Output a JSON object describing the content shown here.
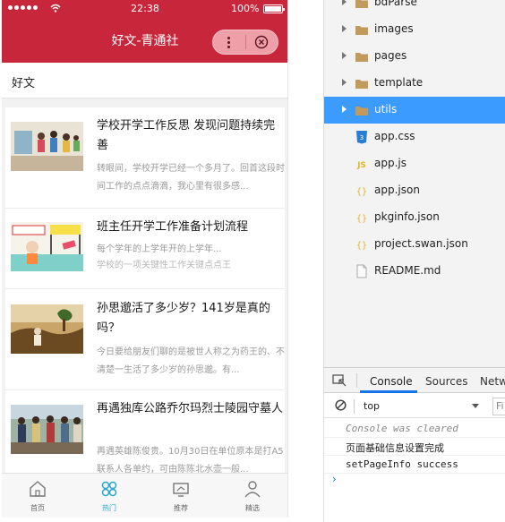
{
  "simulator": {
    "status_bar": {
      "time": "22:38",
      "battery": "100%"
    },
    "navbar": {
      "title": "好文-青通社"
    },
    "section_title": "好文",
    "articles": [
      {
        "title": "学校开学工作反思 发现问题持续完善",
        "summary": "转眼间，学校开学已经一个多月了。回首这段时间工作的点点滴滴，我心里有很多感..."
      },
      {
        "title": "班主任开学工作准备计划流程",
        "summary": "每个学年的上学年开的上学年...",
        "summary2": "学校的一项关键性工作关键点点王"
      },
      {
        "title": "孙思邈活了多少岁？141岁是真的吗？",
        "summary": "今日要给朋友们聊的是被世人称之为药王的、不清楚一生活了多少岁的孙思邈。有..."
      },
      {
        "title": "再遇独库公路乔尔玛烈士陵园守墓人",
        "summary": "再遇英雄陈俊贵。10月30日在单位原本是打A5联系人各单约，可由陈陈北水壶一般..."
      }
    ],
    "tabbar": [
      {
        "label": "首页",
        "icon": "home-icon"
      },
      {
        "label": "热门",
        "icon": "hot-icon"
      },
      {
        "label": "推荐",
        "icon": "recommend-icon"
      },
      {
        "label": "精选",
        "icon": "featured-icon"
      }
    ]
  },
  "devtools": {
    "file_tree": [
      {
        "name": "bdParse",
        "type": "folder"
      },
      {
        "name": "images",
        "type": "folder"
      },
      {
        "name": "pages",
        "type": "folder"
      },
      {
        "name": "template",
        "type": "folder"
      },
      {
        "name": "utils",
        "type": "folder",
        "selected": true
      },
      {
        "name": "app.css",
        "type": "css"
      },
      {
        "name": "app.js",
        "type": "js"
      },
      {
        "name": "app.json",
        "type": "json"
      },
      {
        "name": "pkginfo.json",
        "type": "json"
      },
      {
        "name": "project.swan.json",
        "type": "json"
      },
      {
        "name": "README.md",
        "type": "md"
      }
    ],
    "console": {
      "tabs": [
        "Console",
        "Sources",
        "Netw"
      ],
      "active_tab": "Console",
      "context": "top",
      "filter_placeholder": "Fi",
      "lines": [
        "Console was cleared",
        "页面基础信息设置完成",
        "setPageInfo success"
      ],
      "prompt": "›"
    }
  },
  "colors": {
    "brand": "#c8273b",
    "tab_active": "#2aa6c8",
    "selection": "#3c9bff"
  }
}
